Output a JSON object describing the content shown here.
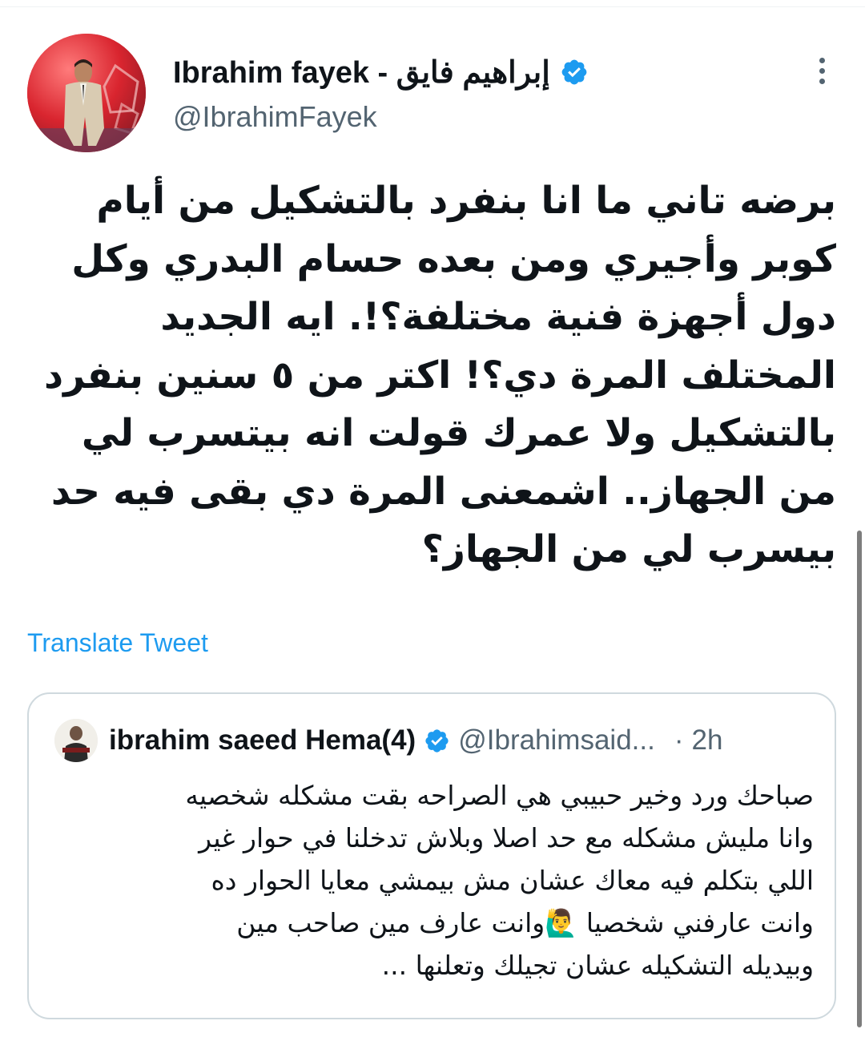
{
  "author": {
    "name": "Ibrahim fayek - إبراهيم فايق",
    "handle": "@IbrahimFayek",
    "verified": true
  },
  "tweet": {
    "text": "برضه تاني ما انا بنفرد بالتشكيل من أيام\nكوبر وأجيري ومن بعده حسام البدري وكل\nدول أجهزة فنية مختلفة؟!. ايه الجديد\nالمختلف المرة دي؟! اكتر من ٥ سنين بنفرد\nبالتشكيل ولا عمرك قولت انه بيتسرب لي\nمن الجهاز.. اشمعنى المرة دي بقى فيه حد\nبيسرب لي من الجهاز؟",
    "translate_label": "Translate Tweet"
  },
  "quoted_tweet": {
    "name": "ibrahim saeed Hema(4)",
    "handle": "@Ibrahimsaid...",
    "separator": "·",
    "time": "2h",
    "verified": true,
    "text_lines": [
      "صباحك ورد وخير حبيبي هي الصراحه بقت مشكله شخصيه",
      "وانا مليش مشكله مع حد اصلا وبلاش تدخلنا في حوار غير",
      "اللي بتكلم فيه معاك عشان مش بيمشي معايا الحوار ده",
      "وانت عارف مين صاحب مين",
      "وانت عارفني شخصيا",
      "وبيديله التشكيله عشان تجيلك وتعلنها ..."
    ]
  },
  "icons": {
    "verified": "verified-badge-icon",
    "more": "more-options-icon",
    "emoji": "person-raising-hand-emoji"
  },
  "colors": {
    "verified_blue": "#1d9bf0",
    "link_blue": "#1d9bf0",
    "secondary_text": "#536471",
    "border": "#cfd9de"
  }
}
